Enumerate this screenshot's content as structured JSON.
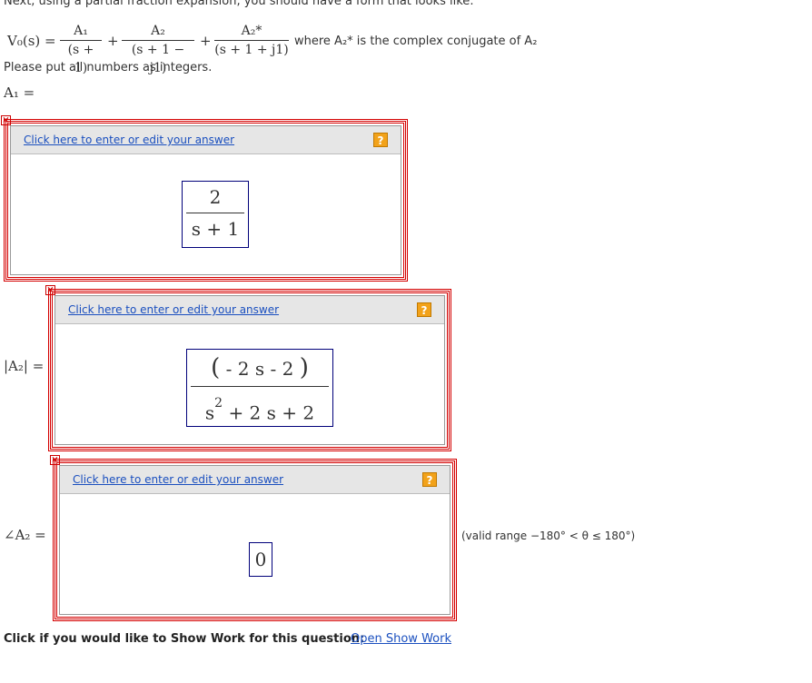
{
  "intro": "Next, using a partial fraction expansion, you should have a form that looks like:",
  "equation": {
    "lhs": "V₀(s) =",
    "term1": {
      "num": "A₁",
      "den": "(s + 1)"
    },
    "term2": {
      "num": "A₂",
      "den": "(s + 1 − j1)"
    },
    "term3": {
      "num": "A₂*",
      "den": "(s + 1 + j1)"
    },
    "plus": "+",
    "where": "where  A₂*  is the complex conjugate of  A₂"
  },
  "instructions": "Please put all numbers as integers.",
  "labels": {
    "a1": "A₁ =",
    "a2_mag": "|A₂| =",
    "a2_angle": "∠A₂ ="
  },
  "widgets": {
    "link_text": "Click here to enter or edit your answer",
    "help_icon": "?",
    "close_icon": "×"
  },
  "answers": {
    "a1": {
      "num": "2",
      "den": "s + 1"
    },
    "a2_mag": {
      "num_open": "(",
      "num_body": "- 2 s - 2",
      "num_close": ")",
      "den_base": "s",
      "den_exp": "2",
      "den_rest": "+ 2 s + 2"
    },
    "a2_angle": "0"
  },
  "valid_range": "(valid range −180°  < θ ≤ 180°)",
  "show_work": {
    "prompt": "Click if you would like to Show Work for this question:",
    "link": "Open Show Work"
  }
}
